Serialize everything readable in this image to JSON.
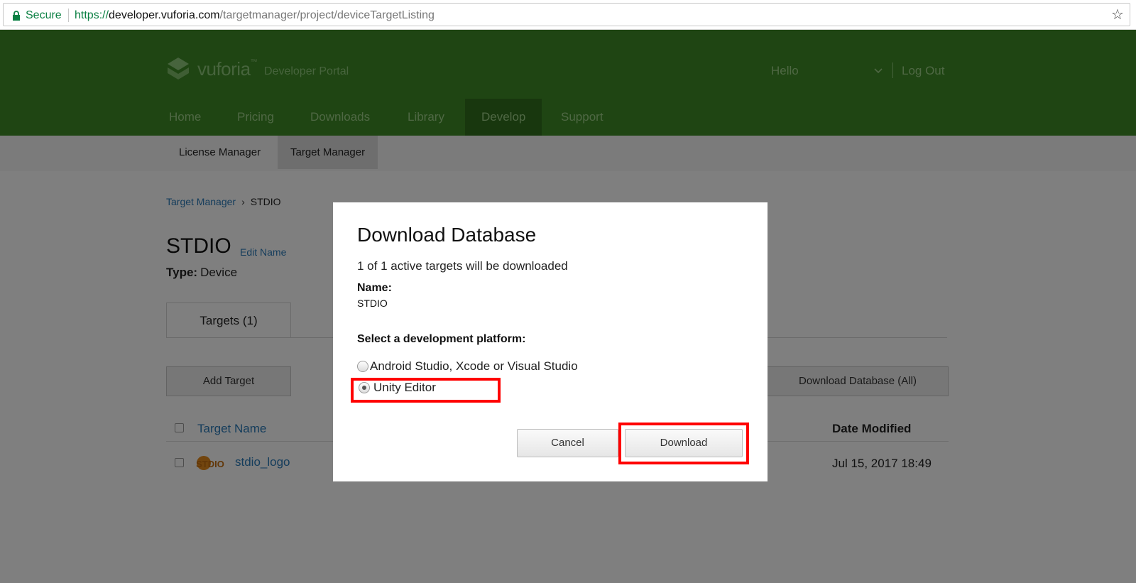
{
  "browser": {
    "secure_label": "Secure",
    "url_scheme": "https://",
    "url_host": "developer.vuforia.com",
    "url_path": "/targetmanager/project/deviceTargetListing"
  },
  "header": {
    "logo_text": "vuforia",
    "logo_tm": "™",
    "portal_text": "Developer Portal",
    "hello": "Hello",
    "logout": "Log Out",
    "brand_color": "#3e8a26",
    "nav": [
      {
        "label": "Home"
      },
      {
        "label": "Pricing"
      },
      {
        "label": "Downloads"
      },
      {
        "label": "Library"
      },
      {
        "label": "Develop",
        "active": true
      },
      {
        "label": "Support"
      }
    ]
  },
  "subnav": [
    {
      "label": "License Manager"
    },
    {
      "label": "Target Manager",
      "active": true
    }
  ],
  "page": {
    "breadcrumb": {
      "link": "Target Manager",
      "separator": "›",
      "current": "STDIO"
    },
    "title": "STDIO",
    "edit_name": "Edit Name",
    "type_label": "Type:",
    "type_value": "Device",
    "tab_targets": "Targets (1)",
    "add_target": "Add Target",
    "download_all": "Download Database (All)",
    "table": {
      "col_name": "Target Name",
      "col_date": "Date Modified",
      "rows": [
        {
          "thumb_text": "STDIO",
          "name": "stdio_logo",
          "date": "Jul 15, 2017 18:49"
        }
      ]
    }
  },
  "modal": {
    "title": "Download Database",
    "count_text": "1 of 1 active targets will be downloaded",
    "name_label": "Name:",
    "name_value": "STDIO",
    "platform_label": "Select a development platform:",
    "options": [
      {
        "label": "Android Studio, Xcode or Visual Studio",
        "selected": false
      },
      {
        "label": "Unity Editor",
        "selected": true
      }
    ],
    "cancel": "Cancel",
    "download": "Download",
    "highlight_color": "#ff0000"
  }
}
